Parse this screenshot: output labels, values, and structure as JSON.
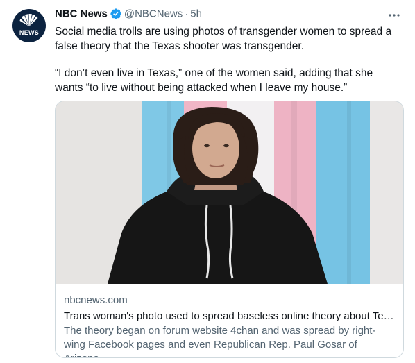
{
  "author": {
    "name": "NBC News",
    "handle": "@NBCNews",
    "separator": "·",
    "time": "5h",
    "avatar_text": "NEWS",
    "verified": true,
    "brand_color": "#0c2340"
  },
  "tweet": {
    "paragraph1": "Social media trolls are using photos of transgender women to spread a false theory that the Texas shooter was transgender.",
    "paragraph2": "“I don’t even live in Texas,” one of the women said, adding that she wants “to live without being attacked when I leave my house.”"
  },
  "card": {
    "domain": "nbcnews.com",
    "title": "Trans woman's photo used to spread baseless online theory about Tex...",
    "description": "The theory began on forum website 4chan and was spread by right-wing Facebook pages and even Republican Rep. Paul Gosar of Arizona."
  },
  "icons": {
    "verified": "verified-badge-icon",
    "more": "more-options-icon",
    "avatar": "nbc-peacock-logo"
  },
  "colors": {
    "verified": "#1d9bf0",
    "secondary_text": "#536471",
    "primary_text": "#0f1419",
    "flag_blue": "#5bcefa",
    "flag_pink": "#f5a9b8",
    "flag_white": "#ffffff"
  }
}
